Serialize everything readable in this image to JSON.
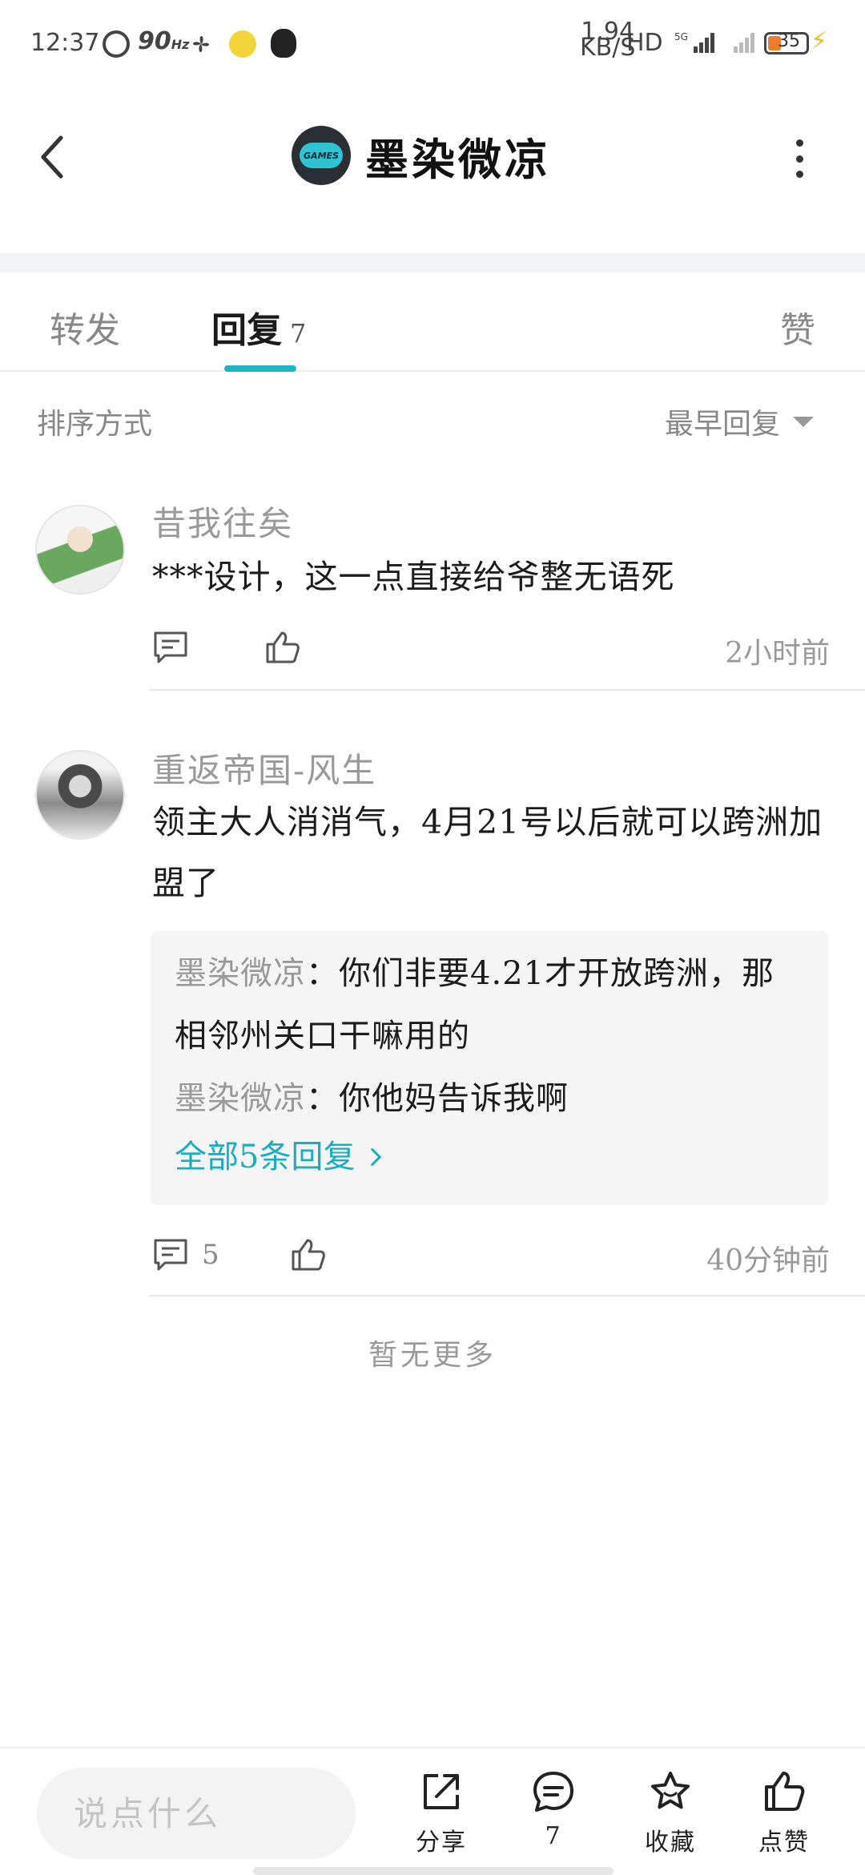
{
  "status_bar": {
    "time": "12:37",
    "refresh_rate": "90",
    "refresh_unit": "Hz",
    "net_speed_value": "1.94",
    "net_speed_unit": "KB/S",
    "hd_label": "HD",
    "network_label": "5G",
    "battery_level": "35",
    "battery_color": "#f07b2a",
    "charging_color": "#f0b81c"
  },
  "header": {
    "title": "墨染微凉",
    "avatar_badge": "GAMES",
    "accent_color": "#2fc4d4"
  },
  "tabs": {
    "forward": "转发",
    "reply": "回复",
    "reply_count": "7",
    "like": "赞",
    "active_color": "#19b6c4"
  },
  "sort": {
    "label": "排序方式",
    "selected": "最早回复"
  },
  "comments": [
    {
      "author": "昔我往矣",
      "text": "***设计，这一点直接给爷整无语死",
      "time": "2小时前",
      "comment_count": "",
      "like_count": ""
    },
    {
      "author": "重返帝国-风生",
      "text": "领主大人消消气，4月21号以后就可以跨洲加盟了",
      "time": "40分钟前",
      "comment_count": "5",
      "like_count": "",
      "sub_replies": [
        {
          "author": "墨染微凉",
          "sep": "：",
          "text": "你们非要4.21才开放跨洲，那相邻州关口干嘛用的"
        },
        {
          "author": "墨染微凉",
          "sep": "：",
          "text": "你他妈告诉我啊"
        }
      ],
      "sub_more": "全部5条回复"
    }
  ],
  "no_more": "暂无更多",
  "bottom_bar": {
    "input_placeholder": "说点什么",
    "share": "分享",
    "comment_count": "7",
    "collect": "收藏",
    "like": "点赞"
  }
}
